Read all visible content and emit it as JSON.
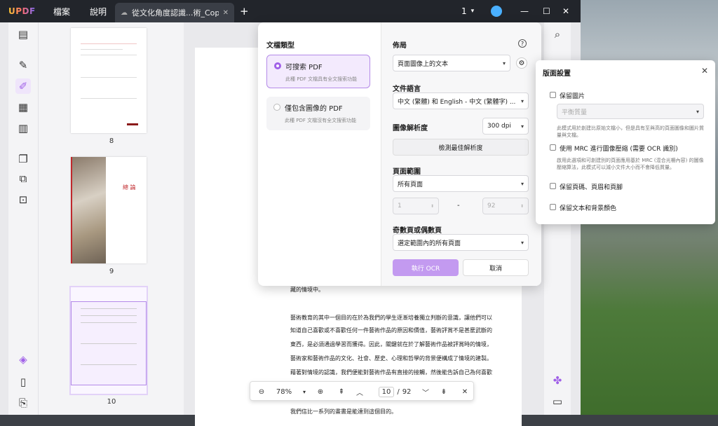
{
  "titlebar": {
    "logo": "UPDF",
    "menu_file": "檔案",
    "menu_help": "說明",
    "tab_title": "從文化角度認識...術_Copy*",
    "tab_close": "✕",
    "add_tab": "+",
    "page_count_indicator": "1",
    "minimize": "—",
    "maximize": "☐",
    "close": "✕"
  },
  "thumbnails": [
    {
      "number": "8"
    },
    {
      "number": "9",
      "caption": "總 論"
    },
    {
      "number": "10"
    }
  ],
  "document": {
    "lines": [
      "藏的情境中。",
      "藝術教育的其中一個目的在於為我們的學生逐漸培養獨立判斷的意識，讓他們可以",
      "知道自己喜歡或不喜歡任何一件藝術作品的原因和價值，藝術評賞不是甚麼武斷的",
      "東西，是必須通過學習而獲得。因此，關鍵就在於了解藝術作品被評賞時的情境，",
      "藝術家和藝術作品的文化、社會、歷史、心理和哲學的背景便構成了情境的建製。",
      "藉著對情境的認識，我們便能對藝術作品有直接的接觸，然後能告訴自己為何喜歡",
      "我們信比一系列的畫書是能達到這個目的。"
    ]
  },
  "ocr_panel": {
    "doc_type_label": "文檔類型",
    "option_searchable": "可搜索 PDF",
    "option_searchable_desc": "此種 PDF 文檔具有全文搜索功能",
    "option_image_only": "僅包含圖像的 PDF",
    "option_image_only_desc": "此種 PDF 文檔沒有全文搜索功能",
    "layout_label": "佈局",
    "layout_value": "頁面圖像上的文本",
    "language_label": "文件語言",
    "language_value": "中文 (繁體) 和 English - 中文 (繁體字) ...",
    "resolution_label": "圖像解析度",
    "resolution_value": "300 dpi",
    "detect_resolution": "檢測最佳解析度",
    "page_range_label": "頁面範圍",
    "page_range_value": "所有頁面",
    "range_from": "1",
    "range_dash": "-",
    "range_to": "92",
    "odd_even_label": "奇數頁或偶數頁",
    "odd_even_value": "選定範圍內的所有頁面",
    "run_ocr": "執行 OCR",
    "cancel": "取消"
  },
  "layout_settings": {
    "title": "版面設置",
    "keep_images": "保留圖片",
    "quality_placeholder": "平衡質量",
    "quality_note": "此模式用於創建比原始文檔小，但是具有至與高的頁面圖像和圖片質量與文檔。",
    "mrc_label": "使用 MRC 進行圖像壓縮 (需要 OCR 識別)",
    "mrc_note": "啟用此選項和可創建別的頁面應用基於 MRC (混合光柵內容) 的圖像壓縮算法，此模式可以減小文件大小而不會降低質量。",
    "keep_header_footer": "保留頁碼、頁眉和頁腳",
    "keep_text_bg": "保留文本和背景顏色"
  },
  "zoombar": {
    "zoom_value": "78%",
    "current_page": "10",
    "separator": "/",
    "total_pages": "92"
  },
  "colors": {
    "accent": "#a060e8",
    "accent_light": "#f3eafd",
    "run_button": "#c39af0",
    "titlebar": "#22252b"
  }
}
